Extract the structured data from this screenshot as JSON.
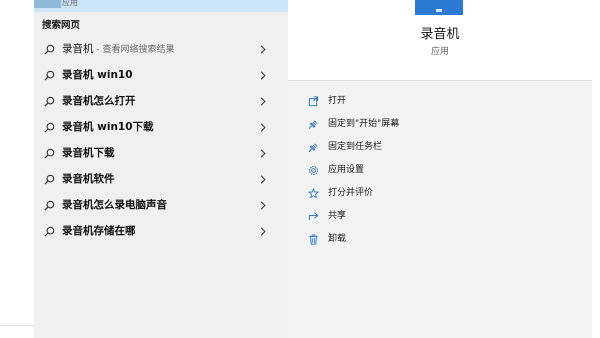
{
  "best_match": {
    "subtitle": "应用"
  },
  "web_section": {
    "header": "搜索网页",
    "results": [
      {
        "text": "录音机",
        "hint": " - 查看网络搜索结果",
        "bold": false
      },
      {
        "text": "录音机 win10",
        "hint": "",
        "bold": true
      },
      {
        "text": "录音机怎么打开",
        "hint": "",
        "bold": true
      },
      {
        "text": "录音机 win10下载",
        "hint": "",
        "bold": true
      },
      {
        "text": "录音机下载",
        "hint": "",
        "bold": true
      },
      {
        "text": "录音机软件",
        "hint": "",
        "bold": true
      },
      {
        "text": "录音机怎么录电脑声音",
        "hint": "",
        "bold": true
      },
      {
        "text": "录音机存储在哪",
        "hint": "",
        "bold": true
      }
    ]
  },
  "detail": {
    "app_name": "录音机",
    "app_type": "应用",
    "actions": [
      {
        "label": "打开",
        "icon": "open-icon"
      },
      {
        "label": "固定到\"开始\"屏幕",
        "icon": "pin-icon"
      },
      {
        "label": "固定到任务栏",
        "icon": "pin-icon"
      },
      {
        "label": "应用设置",
        "icon": "gear-icon"
      },
      {
        "label": "打分并评价",
        "icon": "star-icon"
      },
      {
        "label": "共享",
        "icon": "share-icon"
      },
      {
        "label": "卸载",
        "icon": "trash-icon"
      }
    ]
  },
  "colors": {
    "accent": "#2b7bd3",
    "selected": "#cce4f7",
    "pane_bg": "#f0f0f0"
  }
}
